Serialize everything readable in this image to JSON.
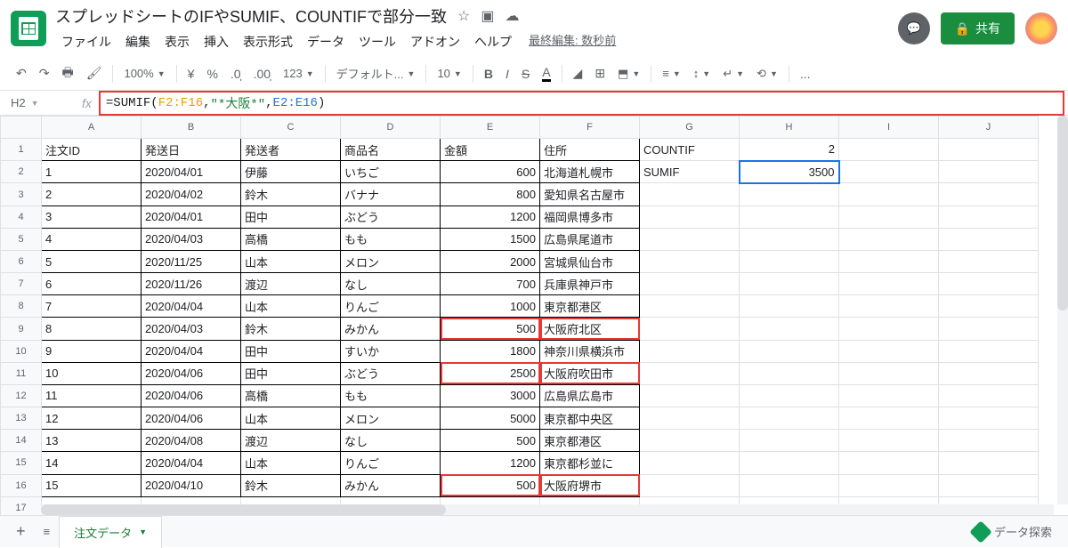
{
  "doc_title": "スプレッドシートのIFやSUMIF、COUNTIFで部分一致",
  "last_edit": "最終編集: 数秒前",
  "share_label": "共有",
  "menus": [
    "ファイル",
    "編集",
    "表示",
    "挿入",
    "表示形式",
    "データ",
    "ツール",
    "アドオン",
    "ヘルプ"
  ],
  "toolbar": {
    "zoom": "100%",
    "currency": "¥",
    "percent": "%",
    "dec_dec": ".0",
    "inc_dec": ".00",
    "format": "123",
    "font": "デフォルト...",
    "size": "10",
    "more": "..."
  },
  "name_box": "H2",
  "formula": {
    "prefix": "=SUMIF(",
    "range1": "F2:F16",
    "sep1": ",",
    "str": "\"*大阪*\"",
    "sep2": ",",
    "range2": "E2:E16",
    "suffix": ")"
  },
  "cols": [
    "A",
    "B",
    "C",
    "D",
    "E",
    "F",
    "G",
    "H",
    "I",
    "J"
  ],
  "headers": [
    "注文ID",
    "発送日",
    "発送者",
    "商品名",
    "金額",
    "住所"
  ],
  "side": {
    "g1": "COUNTIF",
    "h1": "2",
    "g2": "SUMIF",
    "h2": "3500"
  },
  "rows": [
    {
      "a": "1",
      "b": "2020/04/01",
      "c": "伊藤",
      "d": "いちご",
      "e": "600",
      "f": "北海道札幌市"
    },
    {
      "a": "2",
      "b": "2020/04/02",
      "c": "鈴木",
      "d": "バナナ",
      "e": "800",
      "f": "愛知県名古屋市"
    },
    {
      "a": "3",
      "b": "2020/04/01",
      "c": "田中",
      "d": "ぶどう",
      "e": "1200",
      "f": "福岡県博多市"
    },
    {
      "a": "4",
      "b": "2020/04/03",
      "c": "高橋",
      "d": "もも",
      "e": "1500",
      "f": "広島県尾道市"
    },
    {
      "a": "5",
      "b": "2020/11/25",
      "c": "山本",
      "d": "メロン",
      "e": "2000",
      "f": "宮城県仙台市"
    },
    {
      "a": "6",
      "b": "2020/11/26",
      "c": "渡辺",
      "d": "なし",
      "e": "700",
      "f": "兵庫県神戸市"
    },
    {
      "a": "7",
      "b": "2020/04/04",
      "c": "山本",
      "d": "りんご",
      "e": "1000",
      "f": "東京都港区"
    },
    {
      "a": "8",
      "b": "2020/04/03",
      "c": "鈴木",
      "d": "みかん",
      "e": "500",
      "f": "大阪府北区",
      "hl": true
    },
    {
      "a": "9",
      "b": "2020/04/04",
      "c": "田中",
      "d": "すいか",
      "e": "1800",
      "f": "神奈川県横浜市"
    },
    {
      "a": "10",
      "b": "2020/04/06",
      "c": "田中",
      "d": "ぶどう",
      "e": "2500",
      "f": "大阪府吹田市",
      "hl": true
    },
    {
      "a": "11",
      "b": "2020/04/06",
      "c": "高橋",
      "d": "もも",
      "e": "3000",
      "f": "広島県広島市"
    },
    {
      "a": "12",
      "b": "2020/04/06",
      "c": "山本",
      "d": "メロン",
      "e": "5000",
      "f": "東京都中央区"
    },
    {
      "a": "13",
      "b": "2020/04/08",
      "c": "渡辺",
      "d": "なし",
      "e": "500",
      "f": "東京都港区"
    },
    {
      "a": "14",
      "b": "2020/04/04",
      "c": "山本",
      "d": "りんご",
      "e": "1200",
      "f": "東京都杉並に"
    },
    {
      "a": "15",
      "b": "2020/04/10",
      "c": "鈴木",
      "d": "みかん",
      "e": "500",
      "f": "大阪府堺市",
      "hl": true
    }
  ],
  "sheet_tab": "注文データ",
  "explore": "データ探索"
}
